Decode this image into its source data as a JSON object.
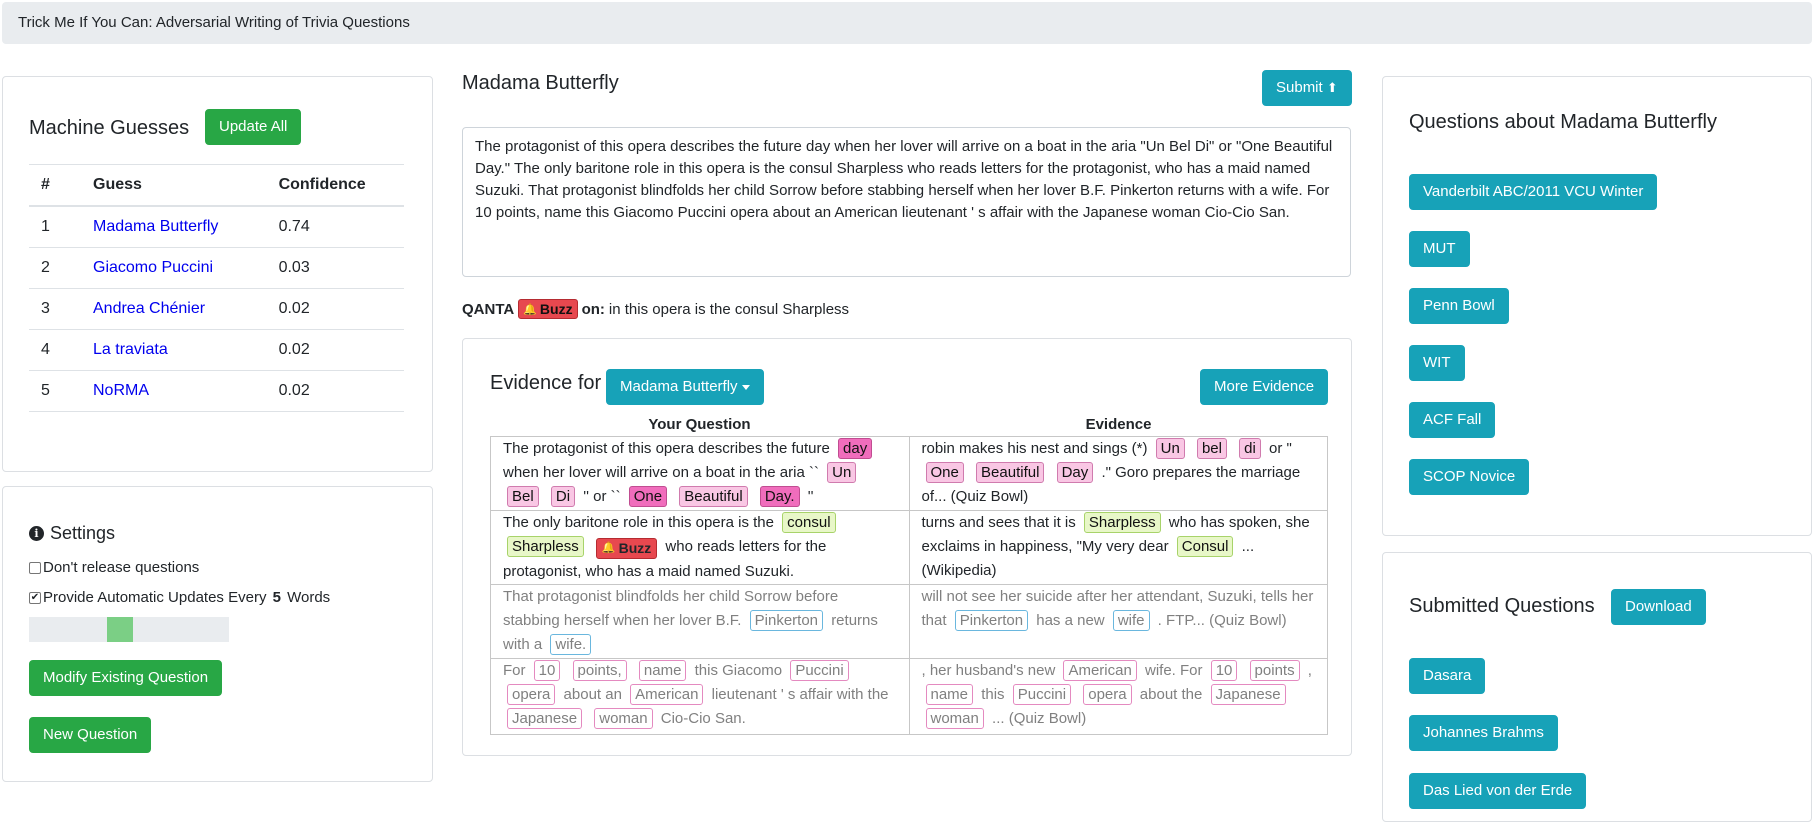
{
  "app": {
    "title": "Trick Me If You Can: Adversarial Writing of Trivia Questions"
  },
  "machine_guesses": {
    "title": "Machine Guesses",
    "update_label": "Update All",
    "columns": [
      "#",
      "Guess",
      "Confidence"
    ],
    "rows": [
      {
        "n": "1",
        "guess": "Madama Butterfly",
        "conf": "0.74"
      },
      {
        "n": "2",
        "guess": "Giacomo Puccini",
        "conf": "0.03"
      },
      {
        "n": "3",
        "guess": "Andrea Chénier",
        "conf": "0.02"
      },
      {
        "n": "4",
        "guess": "La traviata",
        "conf": "0.02"
      },
      {
        "n": "5",
        "guess": "NoRMA",
        "conf": "0.02"
      }
    ]
  },
  "settings": {
    "title": "Settings",
    "icon": "info-icon",
    "dont_release": {
      "label": "Don't release questions",
      "checked": false
    },
    "auto_update": {
      "prefix": "Provide Automatic Updates Every ",
      "count": "5",
      "suffix": " Words",
      "checked": true
    },
    "progress_fraction": 0.12,
    "modify_label": "Modify Existing Question",
    "new_label": "New Question"
  },
  "question": {
    "title": "Madama Butterfly",
    "submit_label": "Submit",
    "text": "The protagonist of this opera describes the future day when her lover will arrive on a boat in the aria \"Un Bel Di\" or \"One Beautiful Day.\" The only baritone role in this opera is the consul Sharpless who reads letters for the protagonist, who has a maid named Suzuki. That protagonist blindfolds her child Sorrow before stabbing herself when her lover B.F. Pinkerton returns with a wife. For 10 points, name this Giacomo Puccini opera about an American lieutenant ' s affair with the Japanese woman Cio-Cio San.",
    "buzz": {
      "agent": "QANTA",
      "label": "Buzz",
      "on": "on:",
      "text": "in this opera is the consul Sharpless"
    }
  },
  "evidence": {
    "title": "Evidence for",
    "selected": "Madama Butterfly",
    "more_label": "More Evidence",
    "col_question": "Your Question",
    "col_evidence": "Evidence",
    "r1q": {
      "a": "The protagonist of this opera describes the future",
      "b": "day",
      "c": "when her lover will arrive on a boat in the aria ``",
      "d": "Un",
      "e": "Bel",
      "f": "Di",
      "g": "'' or ``",
      "h": "One",
      "i": "Beautiful",
      "j": "Day.",
      "k": "''"
    },
    "r1e": {
      "a": "robin makes his nest and sings (*)",
      "b": "Un",
      "c": "bel",
      "d": "di",
      "e": "or \"",
      "f": "One",
      "g": "Beautiful",
      "h": "Day",
      "i": ".\" Goro prepares the marriage of... (Quiz Bowl)"
    },
    "r2q": {
      "a": "The only baritone role in this opera is the",
      "b": "consul",
      "c": "Sharpless",
      "buzz": "Buzz",
      "d": "who reads letters for the protagonist, who has a maid named Suzuki."
    },
    "r2e": {
      "a": "turns and sees that it is",
      "b": "Sharpless",
      "c": "who has spoken, she exclaims in happiness, \"My very dear",
      "d": "Consul",
      "e": "... (Wikipedia)"
    },
    "r3q": {
      "a": "That protagonist blindfolds her child Sorrow before stabbing herself when her lover B.F.",
      "b": "Pinkerton",
      "c": "returns with a",
      "d": "wife."
    },
    "r3e": {
      "a": "will not see her suicide after her attendant, Suzuki, tells her that",
      "b": "Pinkerton",
      "c": "has a new",
      "d": "wife",
      "e": ". FTP... (Quiz Bowl)"
    },
    "r4q": {
      "a": "For",
      "b": "10",
      "c": "points,",
      "d": "name",
      "e": "this Giacomo",
      "f": "Puccini",
      "g": "opera",
      "h": "about an",
      "i": "American",
      "j": "lieutenant ' s affair with the",
      "k": "Japanese",
      "l": "woman",
      "m": "Cio-Cio San."
    },
    "r4e": {
      "a": ", her husband's new",
      "b": "American",
      "c": "wife. For",
      "d": "10",
      "e": "points",
      "f": ",",
      "g": "name",
      "h": "this",
      "i": "Puccini",
      "j": "opera",
      "k": "about the",
      "l": "Japanese",
      "m": "woman",
      "n": "... (Quiz Bowl)"
    }
  },
  "related": {
    "title": "Questions about Madama Butterfly",
    "items": [
      "Vanderbilt ABC/2011 VCU Winter",
      "MUT",
      "Penn Bowl",
      "WIT",
      "ACF Fall",
      "SCOP Novice"
    ]
  },
  "submitted": {
    "title": "Submitted Questions",
    "download_label": "Download",
    "items": [
      "Dasara",
      "Johannes Brahms",
      "Das Lied von der Erde"
    ]
  },
  "colors": {
    "green": "#28a745",
    "teal": "#17a2b8",
    "buzz": "#e7484f"
  }
}
